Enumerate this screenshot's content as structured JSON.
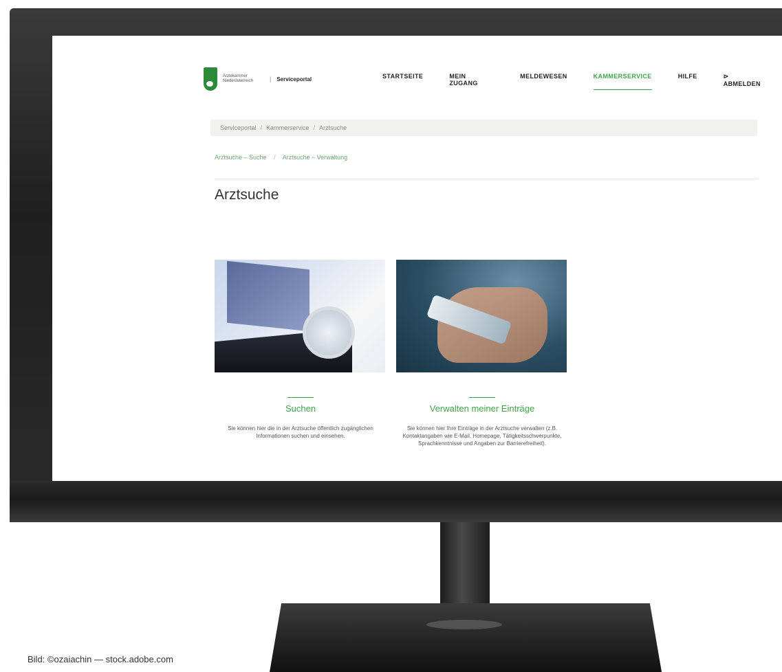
{
  "header": {
    "logo_text": "Ärztekammer Niederösterreich",
    "portal_name": "Serviceportal",
    "separator": "|"
  },
  "nav": {
    "items": [
      {
        "label": "STARTSEITE",
        "active": false
      },
      {
        "label": "MEIN ZUGANG",
        "active": false
      },
      {
        "label": "MELDEWESEN",
        "active": false
      },
      {
        "label": "KAMMERSERVICE",
        "active": true
      },
      {
        "label": "HILFE",
        "active": false
      },
      {
        "label": "⊳ ABMELDEN",
        "active": false
      }
    ]
  },
  "breadcrumb": {
    "items": [
      "Serviceportal",
      "Kammerservice",
      "Arztsuche"
    ],
    "separator": "/"
  },
  "subnav": {
    "items": [
      "Arztsuche – Suche",
      "Arztsuche – Verwaltung"
    ],
    "separator": "/"
  },
  "page": {
    "title": "Arztsuche"
  },
  "cards": [
    {
      "title": "Suchen",
      "text": "Sie können hier die in der Arztsuche öffentlich zugänglichen Informationen suchen und einsehen."
    },
    {
      "title": "Verwalten meiner Einträge",
      "text": "Sie können hier Ihre Einträge in der Arztsuche verwalten (z.B. Kontaktangaben wie E-Mail, Homepage, Tätigkeitsschwerpunkte, Sprachkenntnisse und Angaben zur Barrierefreiheit)."
    }
  ],
  "credit": "Bild: ©ozaiachin — stock.adobe.com",
  "colors": {
    "accent": "#3fa548",
    "breadcrumb_bg": "#f1f1f0",
    "frame": "#1f1f1f"
  }
}
